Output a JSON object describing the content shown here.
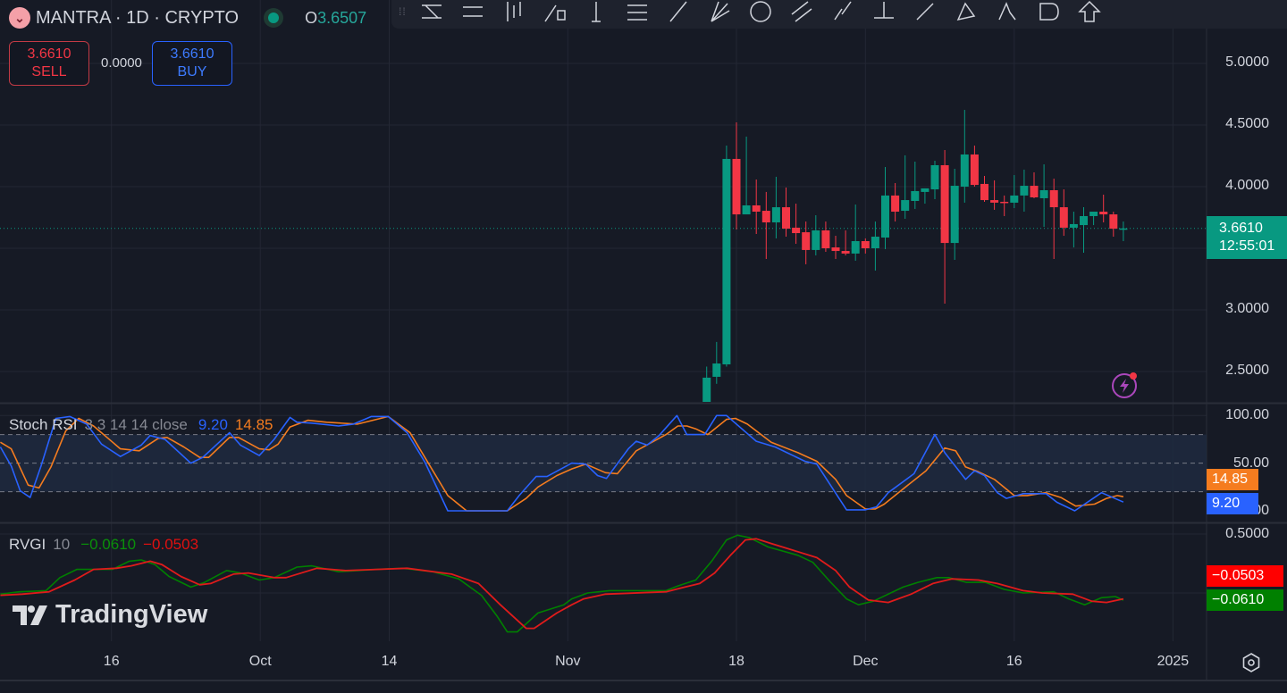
{
  "header": {
    "symbol_title": "MANTRA · 1D · CRYPTO",
    "open_label": "O",
    "open_value": "3.6507",
    "sell_price": "3.6610",
    "sell_label": "SELL",
    "spread": "0.0000",
    "buy_price": "3.6610",
    "buy_label": "BUY"
  },
  "toolbar": {
    "icons": [
      "trend-line-icon",
      "parallel-channel-icon",
      "long-position-icon",
      "rectangle-icon",
      "vertical-line-icon",
      "fib-retracement-icon",
      "ray-icon",
      "pitchfork-icon",
      "circle-icon",
      "parallel-lines-icon",
      "info-line-icon",
      "horizontal-ray-icon",
      "extended-line-icon",
      "triangle-pattern-icon",
      "abcd-pattern-icon",
      "shape-icon",
      "arrow-up-icon"
    ]
  },
  "colors": {
    "up": "#089981",
    "down": "#f23645",
    "stoch_k": "#2962ff",
    "stoch_d": "#f57c1f",
    "rvgi": "#008000",
    "rvgi_signal": "#ff0000",
    "background": "#161a25"
  },
  "price_axis": {
    "labels": [
      "5.0000",
      "4.5000",
      "4.0000",
      "3.0000",
      "2.5000"
    ],
    "current_price": "3.6610",
    "countdown": "12:55:01"
  },
  "stoch_rsi": {
    "name": "Stoch RSI",
    "params": "3 3 14 14 close",
    "k_value": "9.20",
    "d_value": "14.85",
    "axis_labels": [
      "100.00",
      "50.00",
      "0.00"
    ]
  },
  "rvgi": {
    "name": "RVGI",
    "params": "10",
    "rvgi_value": "−0.0610",
    "signal_value": "−0.0503",
    "axis_labels": [
      "0.5000"
    ]
  },
  "time_axis": {
    "labels": [
      {
        "text": "16",
        "day": -63
      },
      {
        "text": "Oct",
        "day": -48
      },
      {
        "text": "14",
        "day": -35
      },
      {
        "text": "Nov",
        "day": -17
      },
      {
        "text": "18",
        "day": 0
      },
      {
        "text": "Dec",
        "day": 13
      },
      {
        "text": "16",
        "day": 28
      },
      {
        "text": "2025",
        "day": 44
      }
    ]
  },
  "branding": {
    "logo_text": "TradingView"
  },
  "chart_data": {
    "type": "candlestick",
    "x_unit": "days relative to Nov 18",
    "price_ylim": [
      2.25,
      5.55
    ],
    "current_price": 3.661,
    "candles": [
      {
        "day": -3,
        "o": 2.22,
        "h": 2.54,
        "l": 2.15,
        "c": 2.45
      },
      {
        "day": -2,
        "o": 2.457,
        "h": 2.74,
        "l": 2.4,
        "c": 2.565
      },
      {
        "day": -1,
        "o": 2.558,
        "h": 4.333,
        "l": 2.54,
        "c": 4.225
      },
      {
        "day": 0,
        "o": 4.225,
        "h": 4.522,
        "l": 3.652,
        "c": 3.775
      },
      {
        "day": 1,
        "o": 3.775,
        "h": 4.406,
        "l": 3.775,
        "c": 3.848
      },
      {
        "day": 2,
        "o": 3.848,
        "h": 4.058,
        "l": 3.616,
        "c": 3.797
      },
      {
        "day": 3,
        "o": 3.804,
        "h": 3.957,
        "l": 3.413,
        "c": 3.71
      },
      {
        "day": 4,
        "o": 3.71,
        "h": 4.08,
        "l": 3.58,
        "c": 3.833
      },
      {
        "day": 5,
        "o": 3.833,
        "h": 3.993,
        "l": 3.594,
        "c": 3.659
      },
      {
        "day": 6,
        "o": 3.667,
        "h": 3.862,
        "l": 3.536,
        "c": 3.623
      },
      {
        "day": 7,
        "o": 3.63,
        "h": 3.717,
        "l": 3.37,
        "c": 3.486
      },
      {
        "day": 8,
        "o": 3.486,
        "h": 3.768,
        "l": 3.442,
        "c": 3.645
      },
      {
        "day": 9,
        "o": 3.645,
        "h": 3.717,
        "l": 3.471,
        "c": 3.5
      },
      {
        "day": 10,
        "o": 3.507,
        "h": 3.601,
        "l": 3.413,
        "c": 3.478
      },
      {
        "day": 11,
        "o": 3.478,
        "h": 3.645,
        "l": 3.442,
        "c": 3.457
      },
      {
        "day": 12,
        "o": 3.457,
        "h": 3.855,
        "l": 3.399,
        "c": 3.558
      },
      {
        "day": 13,
        "o": 3.558,
        "h": 3.58,
        "l": 3.457,
        "c": 3.5
      },
      {
        "day": 14,
        "o": 3.5,
        "h": 3.717,
        "l": 3.319,
        "c": 3.594
      },
      {
        "day": 15,
        "o": 3.587,
        "h": 4.159,
        "l": 3.493,
        "c": 3.928
      },
      {
        "day": 16,
        "o": 3.928,
        "h": 4.029,
        "l": 3.717,
        "c": 3.797
      },
      {
        "day": 17,
        "o": 3.804,
        "h": 4.254,
        "l": 3.739,
        "c": 3.891
      },
      {
        "day": 18,
        "o": 3.884,
        "h": 4.203,
        "l": 3.819,
        "c": 3.964
      },
      {
        "day": 19,
        "o": 3.957,
        "h": 3.986,
        "l": 3.862,
        "c": 3.986
      },
      {
        "day": 20,
        "o": 3.978,
        "h": 4.21,
        "l": 3.899,
        "c": 4.174
      },
      {
        "day": 21,
        "o": 4.174,
        "h": 4.297,
        "l": 3.051,
        "c": 3.543
      },
      {
        "day": 22,
        "o": 3.543,
        "h": 4.145,
        "l": 3.406,
        "c": 4.007
      },
      {
        "day": 23,
        "o": 4.0,
        "h": 4.623,
        "l": 3.87,
        "c": 4.261
      },
      {
        "day": 24,
        "o": 4.261,
        "h": 4.333,
        "l": 4.0,
        "c": 4.014
      },
      {
        "day": 25,
        "o": 4.022,
        "h": 4.087,
        "l": 3.877,
        "c": 3.891
      },
      {
        "day": 26,
        "o": 3.891,
        "h": 4.051,
        "l": 3.812,
        "c": 3.87
      },
      {
        "day": 27,
        "o": 3.877,
        "h": 3.928,
        "l": 3.761,
        "c": 3.87
      },
      {
        "day": 28,
        "o": 3.87,
        "h": 4.094,
        "l": 3.826,
        "c": 3.928
      },
      {
        "day": 29,
        "o": 3.928,
        "h": 4.138,
        "l": 3.797,
        "c": 4.007
      },
      {
        "day": 30,
        "o": 4.007,
        "h": 4.116,
        "l": 3.906,
        "c": 3.913
      },
      {
        "day": 31,
        "o": 3.906,
        "h": 4.181,
        "l": 3.674,
        "c": 3.971
      },
      {
        "day": 32,
        "o": 3.971,
        "h": 4.065,
        "l": 3.413,
        "c": 3.833
      },
      {
        "day": 33,
        "o": 3.833,
        "h": 3.978,
        "l": 3.601,
        "c": 3.667
      },
      {
        "day": 34,
        "o": 3.667,
        "h": 3.797,
        "l": 3.507,
        "c": 3.696
      },
      {
        "day": 35,
        "o": 3.688,
        "h": 3.833,
        "l": 3.464,
        "c": 3.761
      },
      {
        "day": 36,
        "o": 3.761,
        "h": 3.797,
        "l": 3.688,
        "c": 3.797
      },
      {
        "day": 37,
        "o": 3.797,
        "h": 3.935,
        "l": 3.71,
        "c": 3.775
      },
      {
        "day": 38,
        "o": 3.775,
        "h": 3.797,
        "l": 3.594,
        "c": 3.659
      },
      {
        "day": 39,
        "o": 3.652,
        "h": 3.717,
        "l": 3.558,
        "c": 3.661
      }
    ],
    "stoch_ylim": [
      0,
      100
    ],
    "stoch_bands": [
      20,
      50,
      80
    ],
    "stoch_k": [
      [
        -74.2,
        67
      ],
      [
        -73.1,
        47
      ],
      [
        -72.2,
        21
      ],
      [
        -71.2,
        14
      ],
      [
        -70.1,
        47
      ],
      [
        -68.6,
        97
      ],
      [
        -67.2,
        99
      ],
      [
        -65.5,
        91
      ],
      [
        -64,
        70
      ],
      [
        -62.1,
        57
      ],
      [
        -60,
        69
      ],
      [
        -59.1,
        79
      ],
      [
        -57.6,
        75
      ],
      [
        -55,
        50
      ],
      [
        -53.8,
        56
      ],
      [
        -51.1,
        82
      ],
      [
        -50,
        69
      ],
      [
        -48.1,
        58
      ],
      [
        -46.6,
        75
      ],
      [
        -45,
        98
      ],
      [
        -44.3,
        93
      ],
      [
        -42.8,
        92
      ],
      [
        -40.1,
        89
      ],
      [
        -38.6,
        91
      ],
      [
        -36.8,
        99
      ],
      [
        -35.1,
        99
      ],
      [
        -33.2,
        82
      ],
      [
        -31.4,
        51
      ],
      [
        -29.1,
        0
      ],
      [
        -23.1,
        0
      ],
      [
        -21.9,
        16
      ],
      [
        -20.2,
        36
      ],
      [
        -19.1,
        36
      ],
      [
        -16.6,
        50
      ],
      [
        -15.2,
        49
      ],
      [
        -14,
        37
      ],
      [
        -13.1,
        34
      ],
      [
        -10.9,
        65
      ],
      [
        -10.1,
        73
      ],
      [
        -9,
        69
      ],
      [
        -7.8,
        79
      ],
      [
        -6,
        100
      ],
      [
        -5,
        80
      ],
      [
        -3.2,
        80
      ],
      [
        -2,
        100
      ],
      [
        -1,
        100
      ],
      [
        2,
        73
      ],
      [
        3.9,
        67
      ],
      [
        6.9,
        52
      ],
      [
        8.1,
        49
      ],
      [
        11.1,
        1
      ],
      [
        13,
        1
      ],
      [
        14.1,
        4
      ],
      [
        15.3,
        19
      ],
      [
        17.9,
        39
      ],
      [
        20,
        80
      ],
      [
        21,
        61
      ],
      [
        23.1,
        33
      ],
      [
        24,
        42
      ],
      [
        25,
        37
      ],
      [
        26.3,
        19
      ],
      [
        27.2,
        13
      ],
      [
        28.9,
        18
      ],
      [
        31.2,
        18
      ],
      [
        32.3,
        9
      ],
      [
        34.1,
        0
      ],
      [
        36.8,
        19
      ],
      [
        39,
        9.2
      ]
    ],
    "stoch_d": [
      [
        -74.2,
        72
      ],
      [
        -73.1,
        65
      ],
      [
        -71.4,
        27
      ],
      [
        -70.3,
        24
      ],
      [
        -69.1,
        46
      ],
      [
        -67.6,
        84
      ],
      [
        -66.3,
        97
      ],
      [
        -64.8,
        89
      ],
      [
        -62.1,
        65
      ],
      [
        -60.2,
        63
      ],
      [
        -58.3,
        76
      ],
      [
        -57.4,
        77
      ],
      [
        -55.7,
        67
      ],
      [
        -54.1,
        56
      ],
      [
        -53.2,
        56
      ],
      [
        -51.1,
        77
      ],
      [
        -50.2,
        77
      ],
      [
        -48.1,
        65
      ],
      [
        -47.1,
        64
      ],
      [
        -46.2,
        70
      ],
      [
        -45,
        88
      ],
      [
        -43.2,
        95
      ],
      [
        -41.3,
        93
      ],
      [
        -38.2,
        91
      ],
      [
        -35.1,
        99
      ],
      [
        -32.9,
        82
      ],
      [
        -29.1,
        16
      ],
      [
        -27.2,
        0
      ],
      [
        -23.1,
        0
      ],
      [
        -21.2,
        13
      ],
      [
        -20,
        25
      ],
      [
        -18.1,
        37
      ],
      [
        -16.6,
        44
      ],
      [
        -15.2,
        49
      ],
      [
        -13.2,
        40
      ],
      [
        -12,
        39
      ],
      [
        -10.1,
        63
      ],
      [
        -7.1,
        80
      ],
      [
        -5.9,
        89
      ],
      [
        -5,
        89
      ],
      [
        -4.1,
        86
      ],
      [
        -2.9,
        80
      ],
      [
        -1,
        96
      ],
      [
        -0.1,
        97
      ],
      [
        1.1,
        91
      ],
      [
        3.5,
        72
      ],
      [
        6.2,
        61
      ],
      [
        8.1,
        52
      ],
      [
        10,
        33
      ],
      [
        11.1,
        16
      ],
      [
        13,
        2
      ],
      [
        14,
        2
      ],
      [
        14.9,
        7
      ],
      [
        16.8,
        23
      ],
      [
        19.1,
        42
      ],
      [
        21,
        66
      ],
      [
        22.1,
        63
      ],
      [
        23.1,
        46
      ],
      [
        24.4,
        41
      ],
      [
        26,
        33
      ],
      [
        28,
        16
      ],
      [
        29.3,
        16
      ],
      [
        31.2,
        19
      ],
      [
        32.7,
        14
      ],
      [
        34.2,
        5
      ],
      [
        36.1,
        7
      ],
      [
        37.3,
        13
      ],
      [
        38.4,
        16
      ],
      [
        39,
        14.85
      ]
    ],
    "rvgi_ylim": [
      -0.5,
      0.6
    ],
    "rvgi_line": [
      [
        -74.2,
        -0.01
      ],
      [
        -72.3,
        0.01
      ],
      [
        -69.6,
        0.02
      ],
      [
        -68.2,
        0.13
      ],
      [
        -66.5,
        0.2
      ],
      [
        -64.6,
        0.2
      ],
      [
        -62.9,
        0.2
      ],
      [
        -61.2,
        0.27
      ],
      [
        -60,
        0.28
      ],
      [
        -58.6,
        0.24
      ],
      [
        -57.2,
        0.14
      ],
      [
        -55,
        0.05
      ],
      [
        -53.6,
        0.09
      ],
      [
        -51.4,
        0.19
      ],
      [
        -50,
        0.17
      ],
      [
        -48.1,
        0.11
      ],
      [
        -46.6,
        0.13
      ],
      [
        -44.3,
        0.22
      ],
      [
        -42.8,
        0.23
      ],
      [
        -40.1,
        0.18
      ],
      [
        -38.2,
        0.19
      ],
      [
        -36.3,
        0.2
      ],
      [
        -33.7,
        0.21
      ],
      [
        -30.6,
        0.18
      ],
      [
        -28,
        0.12
      ],
      [
        -25.7,
        -0.02
      ],
      [
        -24.1,
        -0.2
      ],
      [
        -23.1,
        -0.33
      ],
      [
        -22.1,
        -0.33
      ],
      [
        -20,
        -0.17
      ],
      [
        -17.4,
        -0.1
      ],
      [
        -16.6,
        -0.05
      ],
      [
        -15,
        0
      ],
      [
        -12.8,
        0.02
      ],
      [
        -7.1,
        0.02
      ],
      [
        -5.9,
        0.06
      ],
      [
        -4.1,
        0.11
      ],
      [
        -2.5,
        0.27
      ],
      [
        -1,
        0.45
      ],
      [
        0.1,
        0.49
      ],
      [
        1.3,
        0.47
      ],
      [
        3.2,
        0.39
      ],
      [
        6.2,
        0.32
      ],
      [
        7.7,
        0.26
      ],
      [
        9.5,
        0.09
      ],
      [
        11.1,
        -0.05
      ],
      [
        12.3,
        -0.1
      ],
      [
        13.8,
        -0.07
      ],
      [
        16.8,
        0.05
      ],
      [
        18.3,
        0.09
      ],
      [
        20.2,
        0.13
      ],
      [
        21.4,
        0.13
      ],
      [
        23.2,
        0.09
      ],
      [
        25.1,
        0.09
      ],
      [
        27,
        0.03
      ],
      [
        28.9,
        0
      ],
      [
        32,
        0.01
      ],
      [
        33.5,
        -0.05
      ],
      [
        35.1,
        -0.1
      ],
      [
        36.8,
        -0.04
      ],
      [
        38.2,
        -0.03
      ],
      [
        39,
        -0.061
      ]
    ],
    "rvgi_signal": [
      [
        -74.2,
        -0.02
      ],
      [
        -72,
        -0.01
      ],
      [
        -69.3,
        0.01
      ],
      [
        -66.7,
        0.11
      ],
      [
        -64.8,
        0.2
      ],
      [
        -62.5,
        0.21
      ],
      [
        -61,
        0.23
      ],
      [
        -59.1,
        0.27
      ],
      [
        -57.9,
        0.24
      ],
      [
        -56,
        0.14
      ],
      [
        -54.1,
        0.07
      ],
      [
        -53,
        0.08
      ],
      [
        -50.7,
        0.16
      ],
      [
        -49.2,
        0.17
      ],
      [
        -46.6,
        0.13
      ],
      [
        -45.4,
        0.13
      ],
      [
        -42.3,
        0.21
      ],
      [
        -39.4,
        0.19
      ],
      [
        -36.3,
        0.2
      ],
      [
        -33.2,
        0.21
      ],
      [
        -28.7,
        0.16
      ],
      [
        -26,
        0.08
      ],
      [
        -23.8,
        -0.1
      ],
      [
        -21.2,
        -0.3
      ],
      [
        -20.4,
        -0.3
      ],
      [
        -18.1,
        -0.17
      ],
      [
        -16.6,
        -0.1
      ],
      [
        -15.4,
        -0.05
      ],
      [
        -13.2,
        -0.01
      ],
      [
        -7.1,
        0.01
      ],
      [
        -5.2,
        0.05
      ],
      [
        -3.7,
        0.08
      ],
      [
        -2.2,
        0.17
      ],
      [
        -0.6,
        0.32
      ],
      [
        0.9,
        0.45
      ],
      [
        2,
        0.46
      ],
      [
        3.5,
        0.42
      ],
      [
        6.2,
        0.35
      ],
      [
        8.1,
        0.3
      ],
      [
        10,
        0.19
      ],
      [
        11.4,
        0.05
      ],
      [
        13.3,
        -0.06
      ],
      [
        15.3,
        -0.08
      ],
      [
        17.6,
        -0.01
      ],
      [
        19.8,
        0.08
      ],
      [
        21.7,
        0.12
      ],
      [
        24.4,
        0.11
      ],
      [
        26.3,
        0.08
      ],
      [
        28.9,
        0.02
      ],
      [
        30.8,
        0
      ],
      [
        33.9,
        -0.01
      ],
      [
        35.8,
        -0.07
      ],
      [
        37.3,
        -0.08
      ],
      [
        39,
        -0.0503
      ]
    ]
  }
}
